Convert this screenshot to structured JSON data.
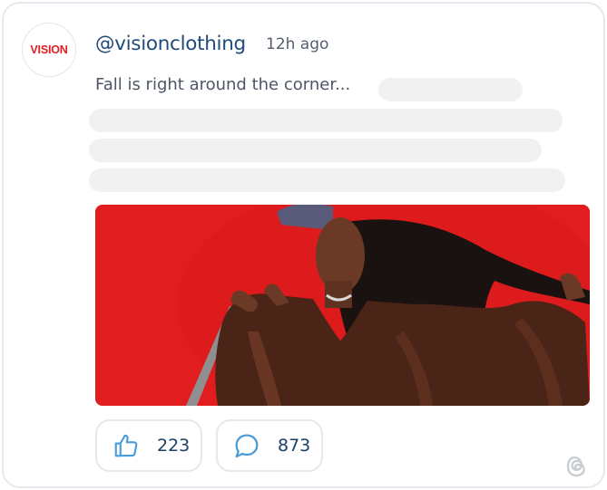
{
  "post": {
    "avatar_text": "VISION",
    "username": "@visionclothing",
    "timestamp": "12h ago",
    "text": "Fall is right around the corner...",
    "image_alt": "Woman in brown leather jacket and cap against red background"
  },
  "actions": {
    "likes_count": "223",
    "comments_count": "873"
  },
  "icons": {
    "like": "thumbs-up-icon",
    "comment": "chat-bubble-icon",
    "platform": "threads-icon"
  },
  "colors": {
    "brand_red": "#e31e24",
    "username_blue": "#1f4a7a",
    "icon_blue": "#4a9bd9",
    "photo_background": "#e21d1f"
  }
}
